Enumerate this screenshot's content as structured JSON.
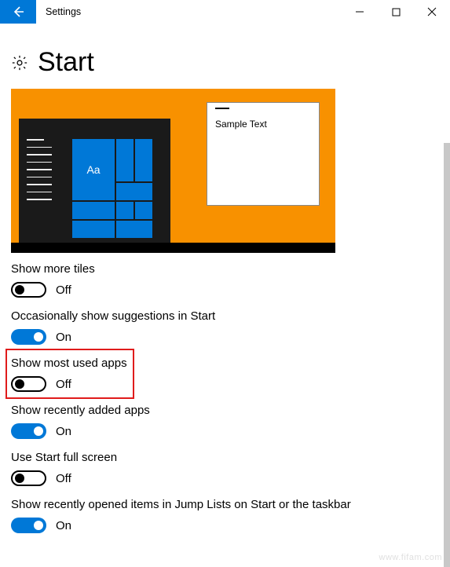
{
  "window": {
    "title": "Settings",
    "sample_window_text": "Sample Text",
    "tile_label": "Aa"
  },
  "page": {
    "heading": "Start"
  },
  "settings": [
    {
      "label": "Show more tiles",
      "on": false,
      "state_text": "Off",
      "highlighted": false
    },
    {
      "label": "Occasionally show suggestions in Start",
      "on": true,
      "state_text": "On",
      "highlighted": false
    },
    {
      "label": "Show most used apps",
      "on": false,
      "state_text": "Off",
      "highlighted": true
    },
    {
      "label": "Show recently added apps",
      "on": true,
      "state_text": "On",
      "highlighted": false
    },
    {
      "label": "Use Start full screen",
      "on": false,
      "state_text": "Off",
      "highlighted": false
    },
    {
      "label": "Show recently opened items in Jump Lists on Start or the taskbar",
      "on": true,
      "state_text": "On",
      "highlighted": false
    }
  ],
  "watermark": "www.fifam.com",
  "colors": {
    "accent": "#0078d7",
    "preview_bg": "#f89100",
    "highlight": "#e01b1b"
  }
}
